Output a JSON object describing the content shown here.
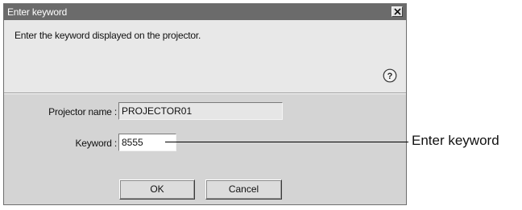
{
  "window": {
    "title": "Enter keyword",
    "close_glyph": "×"
  },
  "instruction": "Enter the keyword displayed on the projector.",
  "help": {
    "icon": "help-icon",
    "glyph": "?"
  },
  "form": {
    "projector_name_label": "Projector name :",
    "projector_name_value": "PROJECTOR01",
    "keyword_label": "Keyword :",
    "keyword_value": "8555"
  },
  "buttons": {
    "ok": "OK",
    "cancel": "Cancel"
  },
  "callout": {
    "text": "Enter keyword"
  }
}
